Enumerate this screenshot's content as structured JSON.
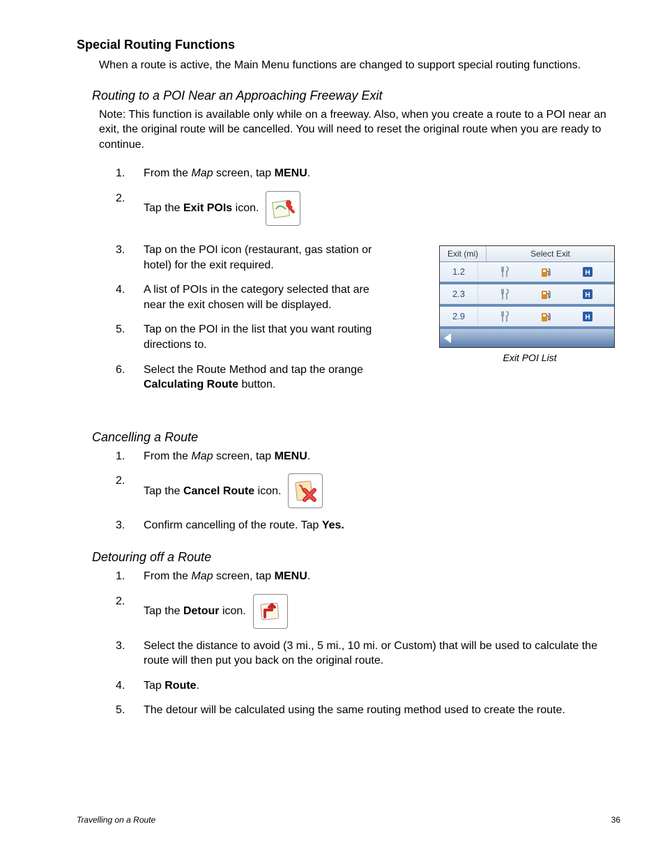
{
  "section_title": "Special Routing Functions",
  "intro": "When a route is active, the Main Menu functions are changed to support special routing functions.",
  "sub1": {
    "title": "Routing to a POI Near an Approaching Freeway Exit",
    "note": "Note: This function is available only while on a freeway.  Also, when you create a route to a POI near an exit, the original route will be cancelled.  You will need to reset the original route when you are ready to continue.",
    "step1_a": "From the ",
    "step1_map": "Map",
    "step1_b": " screen, tap ",
    "step1_menu": "MENU",
    "step1_c": ".",
    "step2_a": "Tap the ",
    "step2_b": "Exit POIs",
    "step2_c": " icon.",
    "step3": "Tap on the POI icon (restaurant, gas station or hotel) for the exit required.",
    "step4": "A list of POIs in the category selected that are near the exit chosen will be displayed.",
    "step5": "Tap on the POI in the list that you want routing directions to.",
    "step6_a": "Select the Route Method and tap the orange ",
    "step6_b": "Calculating Route",
    "step6_c": " button."
  },
  "exit_list": {
    "header_left": "Exit (mi)",
    "header_right": "Select Exit",
    "rows": [
      "1.2",
      "2.3",
      "2.9"
    ],
    "caption": "Exit POI List"
  },
  "sub2": {
    "title": "Cancelling a Route",
    "step1_a": "From the ",
    "step1_map": "Map",
    "step1_b": " screen, tap ",
    "step1_menu": "MENU",
    "step1_c": ".",
    "step2_a": "Tap the ",
    "step2_b": "Cancel Route",
    "step2_c": " icon.",
    "step3_a": "Confirm cancelling of the route.  Tap ",
    "step3_b": "Yes."
  },
  "sub3": {
    "title": "Detouring off a Route",
    "step1_a": "From the ",
    "step1_map": "Map",
    "step1_b": " screen, tap ",
    "step1_menu": "MENU",
    "step1_c": ".",
    "step2_a": "Tap the ",
    "step2_b": "Detour",
    "step2_c": " icon.",
    "step3": "Select the distance to avoid (3 mi., 5 mi., 10 mi. or Custom) that will be used to calculate the route will then put you back on the original route.",
    "step4_a": "Tap ",
    "step4_b": "Route",
    "step4_c": ".",
    "step5": "The detour will be calculated using the same routing method used to create the route."
  },
  "footer_left": "Travelling on a Route",
  "footer_right": "36"
}
